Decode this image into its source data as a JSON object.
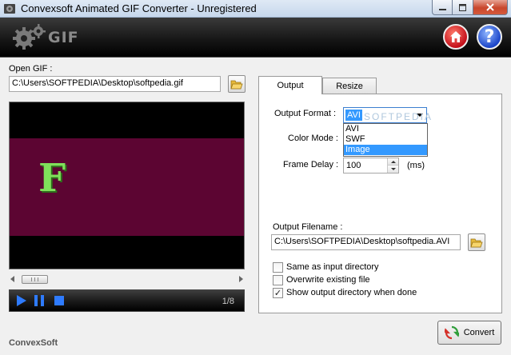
{
  "window": {
    "title": "Convexsoft Animated GIF Converter - Unregistered"
  },
  "header": {
    "logo_text": "GIF"
  },
  "left": {
    "open_gif_label": "Open GIF :",
    "open_gif_path": "C:\\Users\\SOFTPEDIA\\Desktop\\softpedia.gif",
    "preview_letter": "F",
    "frame_counter": "1/8",
    "brand": "ConvexSoft"
  },
  "tabs": [
    {
      "label": "Output",
      "active": true
    },
    {
      "label": "Resize",
      "active": false
    }
  ],
  "output": {
    "format_label": "Output Format :",
    "format_value": "AVI",
    "format_options": [
      "AVI",
      "SWF",
      "Image"
    ],
    "format_highlighted": "Image",
    "color_mode_label": "Color Mode :",
    "frame_delay_label": "Frame Delay :",
    "frame_delay_value": "100",
    "frame_delay_unit": "(ms)",
    "filename_label": "Output Filename :",
    "filename_value": "C:\\Users\\SOFTPEDIA\\Desktop\\softpedia.AVI",
    "checkboxes": [
      {
        "label": "Same as input directory",
        "checked": false
      },
      {
        "label": "Overwrite existing file",
        "checked": false
      },
      {
        "label": "Show output directory when done",
        "checked": true
      }
    ]
  },
  "actions": {
    "convert_label": "Convert"
  },
  "watermark": "SOFTPEDIA",
  "colors": {
    "selection": "#3399ff",
    "preview_frame": "#5c0532",
    "preview_letter": "#7fe05a"
  }
}
